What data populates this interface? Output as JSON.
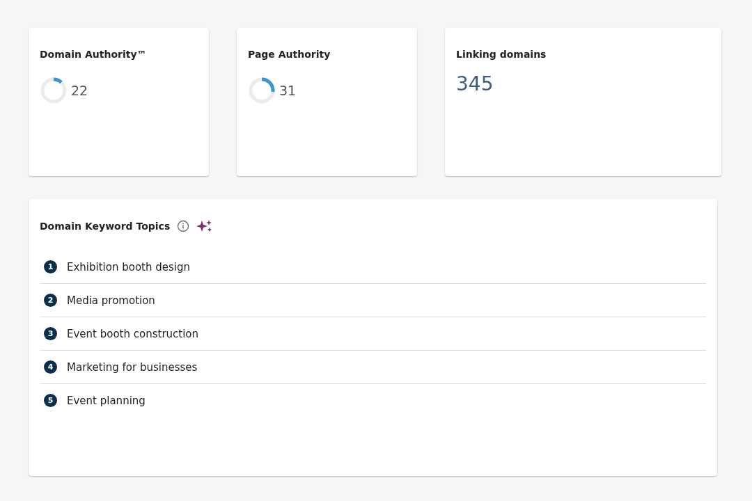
{
  "metrics": [
    {
      "kind": "gauge",
      "title": "Domain Authority™",
      "value": "22",
      "level": 0.12
    },
    {
      "kind": "gauge",
      "title": "Page Authority",
      "value": "31",
      "level": 0.27
    },
    {
      "kind": "number",
      "title": "Linking domains",
      "value": "345"
    }
  ],
  "topics": {
    "title": "Domain Keyword Topics",
    "items": [
      {
        "number": "1",
        "label": "Exhibition booth design"
      },
      {
        "number": "2",
        "label": "Media promotion"
      },
      {
        "number": "3",
        "label": "Event booth construction"
      },
      {
        "number": "4",
        "label": "Marketing for businesses"
      },
      {
        "number": "5",
        "label": "Event planning"
      }
    ]
  }
}
